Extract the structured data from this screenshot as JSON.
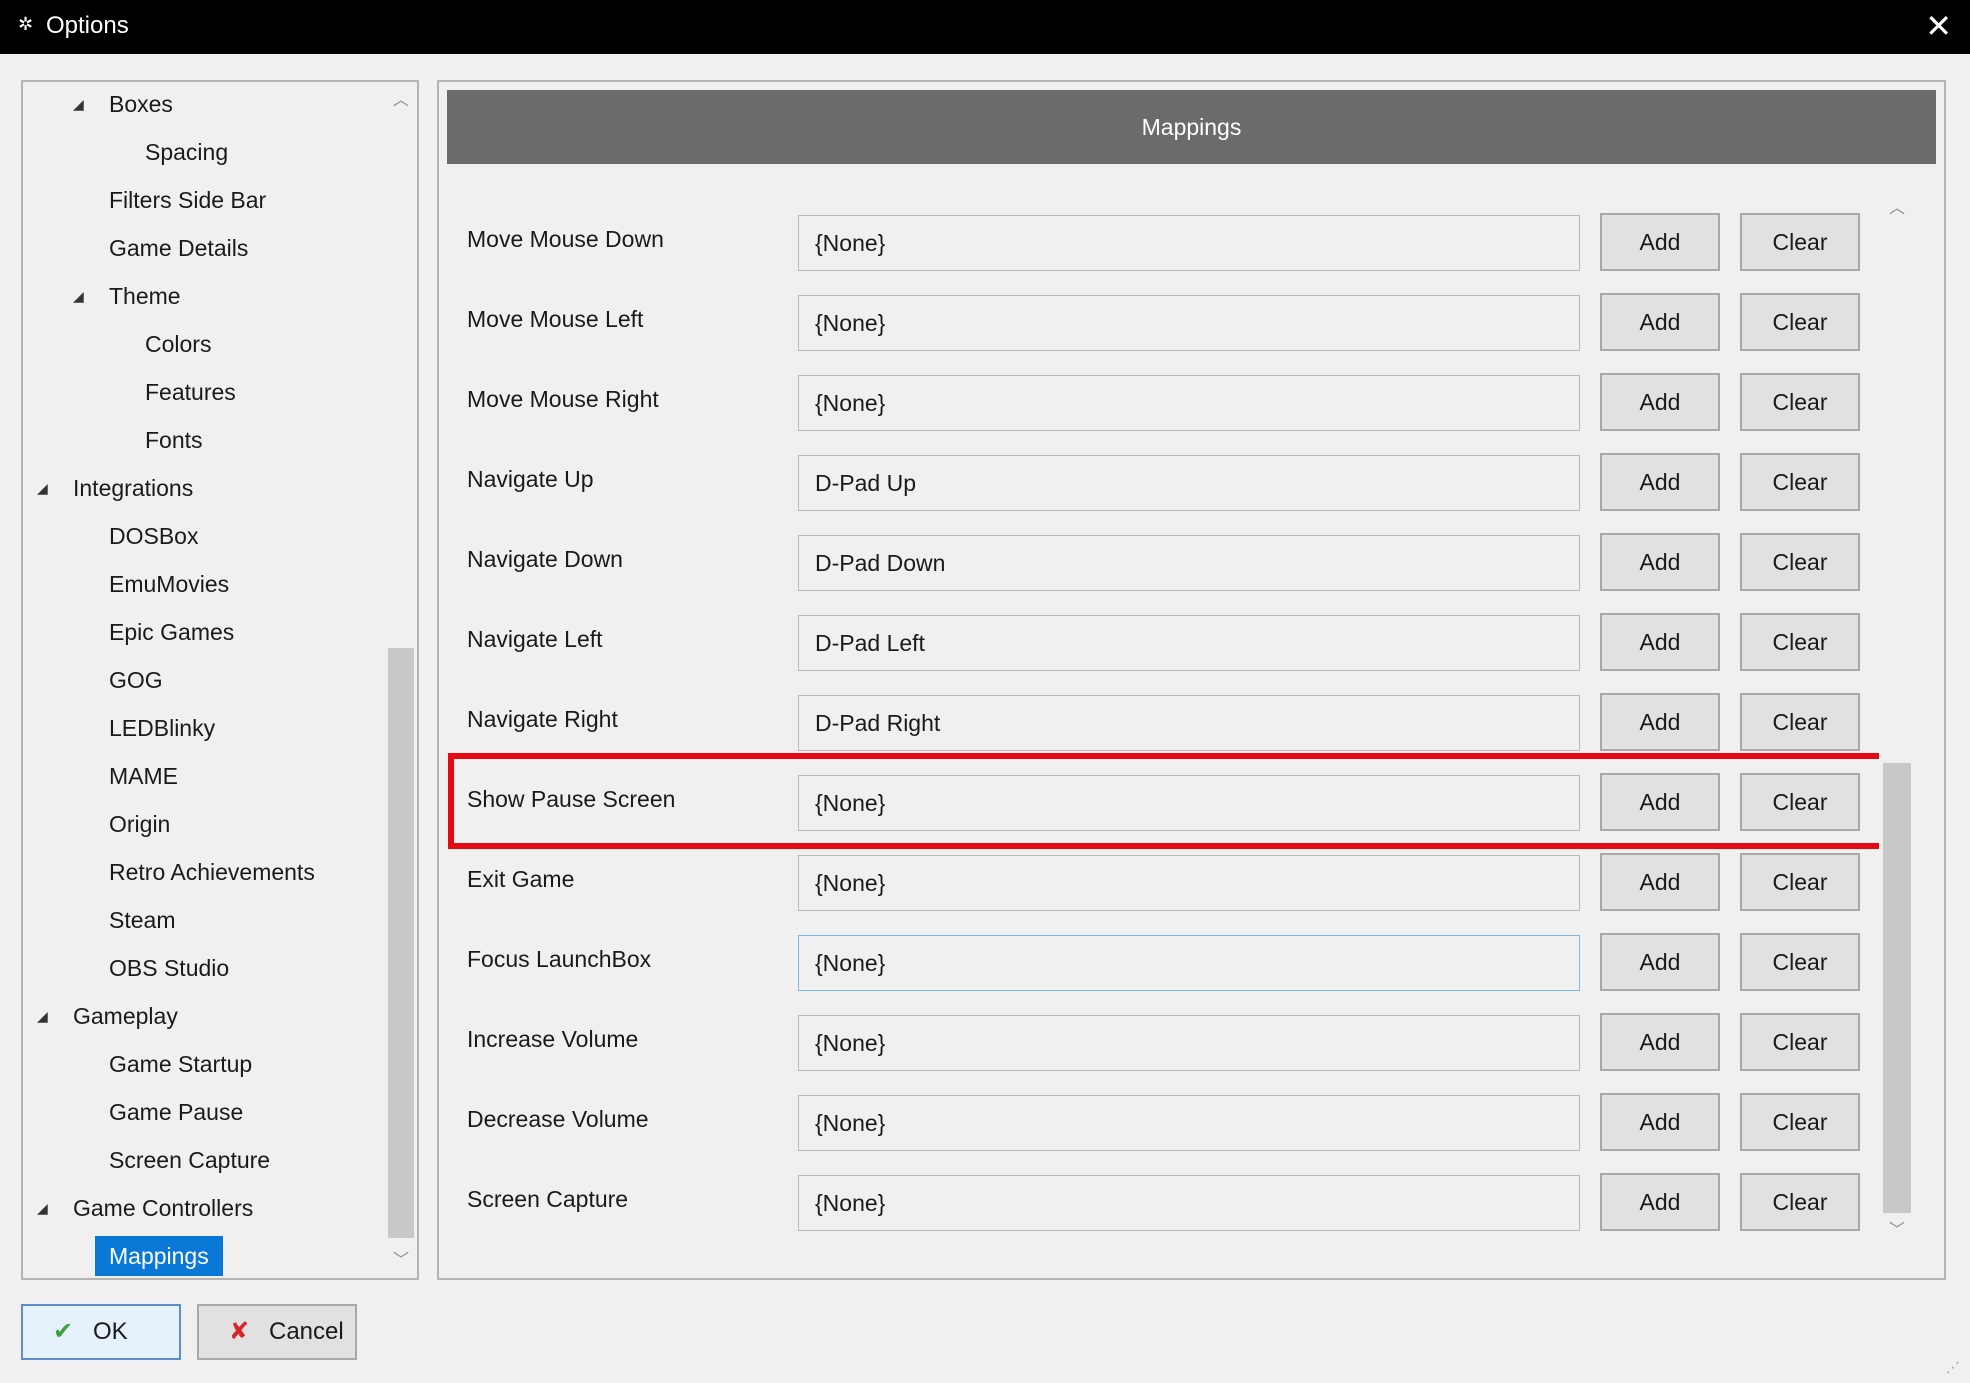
{
  "window": {
    "title": "Options",
    "app_icon": "gear-icon",
    "close_glyph": "✕"
  },
  "tree": {
    "items": [
      {
        "label": "Boxes",
        "expanded": true
      },
      {
        "label": "Spacing"
      },
      {
        "label": "Filters Side Bar"
      },
      {
        "label": "Game Details"
      },
      {
        "label": "Theme",
        "expanded": true
      },
      {
        "label": "Colors"
      },
      {
        "label": "Features"
      },
      {
        "label": "Fonts"
      },
      {
        "label": "Integrations",
        "expanded": true
      },
      {
        "label": "DOSBox"
      },
      {
        "label": "EmuMovies"
      },
      {
        "label": "Epic Games"
      },
      {
        "label": "GOG"
      },
      {
        "label": "LEDBlinky"
      },
      {
        "label": "MAME"
      },
      {
        "label": "Origin"
      },
      {
        "label": "Retro Achievements"
      },
      {
        "label": "Steam"
      },
      {
        "label": "OBS Studio"
      },
      {
        "label": "Gameplay",
        "expanded": true
      },
      {
        "label": "Game Startup"
      },
      {
        "label": "Game Pause"
      },
      {
        "label": "Screen Capture"
      },
      {
        "label": "Game Controllers",
        "expanded": true
      },
      {
        "label": "Mappings",
        "selected": true
      }
    ]
  },
  "mappings": {
    "header": "Mappings",
    "add_label": "Add",
    "clear_label": "Clear",
    "rows": [
      {
        "label": "Move Mouse Down",
        "value": "{None}"
      },
      {
        "label": "Move Mouse Left",
        "value": "{None}"
      },
      {
        "label": "Move Mouse Right",
        "value": "{None}"
      },
      {
        "label": "Navigate Up",
        "value": "D-Pad Up"
      },
      {
        "label": "Navigate Down",
        "value": "D-Pad Down"
      },
      {
        "label": "Navigate Left",
        "value": "D-Pad Left"
      },
      {
        "label": "Navigate Right",
        "value": "D-Pad Right"
      },
      {
        "label": "Show Pause Screen",
        "value": "{None}",
        "highlighted": true
      },
      {
        "label": "Exit Game",
        "value": "{None}"
      },
      {
        "label": "Focus LaunchBox",
        "value": "{None}",
        "focused": true
      },
      {
        "label": "Increase Volume",
        "value": "{None}"
      },
      {
        "label": "Decrease Volume",
        "value": "{None}"
      },
      {
        "label": "Screen Capture",
        "value": "{None}"
      }
    ],
    "highlight_color": "#e50914"
  },
  "footer": {
    "ok_label": "OK",
    "cancel_label": "Cancel"
  },
  "colors": {
    "selection": "#0a78d7",
    "header_bg": "#6b6b6b",
    "titlebar_bg": "#000000"
  }
}
